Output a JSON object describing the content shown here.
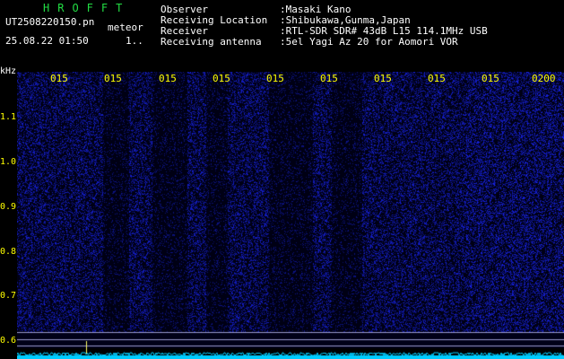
{
  "header": {
    "app_name": "HROFFT",
    "file_name": "UT2508220150.pn",
    "tag": "meteor",
    "date_time": "25.08.22 01:50",
    "count": "1..",
    "info": [
      {
        "label": "Observer",
        "value": ":Masaki Kano"
      },
      {
        "label": "Receiving Location",
        "value": ":Shibukawa,Gunma,Japan"
      },
      {
        "label": "Receiver",
        "value": ":RTL-SDR SDR# 43dB L15 114.1MHz USB"
      },
      {
        "label": "Receiving antenna",
        "value": ":5el Yagi Az 20 for Aomori VOR"
      }
    ]
  },
  "plot": {
    "y_unit": "kHz",
    "y_ticks": [
      "1.1",
      "1.0",
      "0.9",
      "0.8",
      "0.7",
      "0.6"
    ],
    "x_ticks": [
      "015",
      "015",
      "015",
      "015",
      "015",
      "015",
      "015",
      "015",
      "015",
      "0200"
    ],
    "colors": {
      "tick": "#ffff00",
      "noise": "#1a22aa",
      "trace": "#00ccff"
    }
  }
}
